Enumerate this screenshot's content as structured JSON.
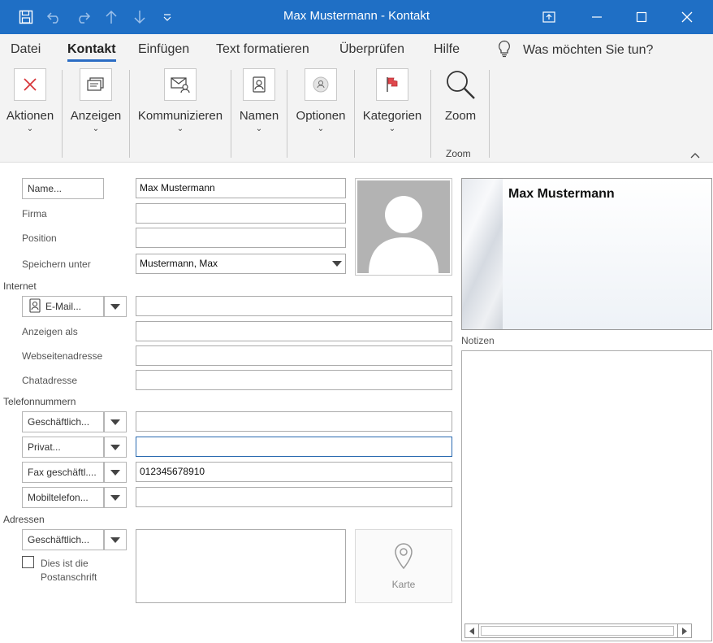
{
  "window": {
    "title": "Max Mustermann  -  Kontakt",
    "minimize_icon": "minimize-icon",
    "maximize_icon": "maximize-icon",
    "close_icon": "close-icon"
  },
  "quick_access": [
    "save-icon",
    "undo-icon",
    "redo-icon",
    "up-arrow-icon",
    "down-arrow-icon",
    "customize-icon"
  ],
  "menu": {
    "tabs": [
      "Datei",
      "Kontakt",
      "Einfügen",
      "Text formatieren",
      "Überprüfen",
      "Hilfe"
    ],
    "active_tab": "Kontakt",
    "tell_me": "Was möchten Sie tun?"
  },
  "ribbon": {
    "groups": [
      {
        "label": "Aktionen",
        "icon": "delete-x-icon"
      },
      {
        "label": "Anzeigen",
        "icon": "card-view-icon"
      },
      {
        "label": "Kommunizieren",
        "icon": "envelope-contact-icon"
      },
      {
        "label": "Namen",
        "icon": "address-book-icon"
      },
      {
        "label": "Optionen",
        "icon": "contact-photo-icon"
      },
      {
        "label": "Kategorien",
        "icon": "red-flag-icon"
      },
      {
        "label": "Zoom",
        "icon": "magnifier-icon"
      }
    ],
    "zoom_group_label": "Zoom"
  },
  "form": {
    "name_button": "Name...",
    "name_value": "Max Mustermann",
    "firma_label": "Firma",
    "firma_value": "",
    "position_label": "Position",
    "position_value": "",
    "speichern_label": "Speichern unter",
    "speichern_value": "Mustermann, Max",
    "internet_section": "Internet",
    "email_button": "E-Mail...",
    "email_value": "",
    "anzeigen_als_label": "Anzeigen als",
    "anzeigen_als_value": "",
    "webseite_label": "Webseitenadresse",
    "webseite_value": "",
    "chat_label": "Chatadresse",
    "chat_value": "",
    "telefon_section": "Telefonnummern",
    "phones": [
      {
        "label": "Geschäftlich...",
        "value": ""
      },
      {
        "label": "Privat...",
        "value": ""
      },
      {
        "label": "Fax geschäftl....",
        "value": "012345678910"
      },
      {
        "label": "Mobiltelefon...",
        "value": ""
      }
    ],
    "adressen_section": "Adressen",
    "address_button": "Geschäftlich...",
    "address_value": "",
    "postanschrift_label": "Dies ist die Postanschrift",
    "postanschrift_checked": false,
    "map_label": "Karte"
  },
  "card": {
    "name": "Max Mustermann"
  },
  "notes": {
    "label": "Notizen",
    "value": ""
  },
  "colors": {
    "titlebar": "#1f6fc5",
    "active_tab_underline": "#2b6cc4",
    "focus_border": "#2a6ab0"
  }
}
